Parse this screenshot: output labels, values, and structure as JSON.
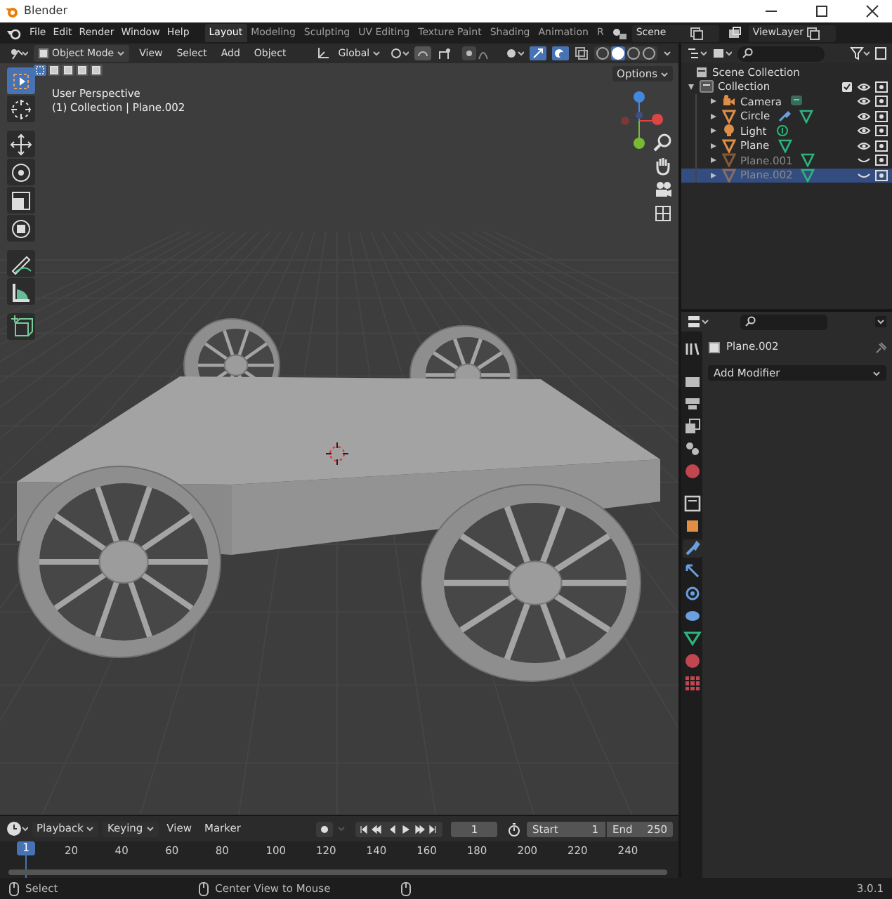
{
  "window": {
    "title": "Blender"
  },
  "menu": [
    "File",
    "Edit",
    "Render",
    "Window",
    "Help"
  ],
  "workspaces": [
    {
      "label": "Layout",
      "selected": true
    },
    {
      "label": "Modeling",
      "selected": false
    },
    {
      "label": "Sculpting",
      "selected": false
    },
    {
      "label": "UV Editing",
      "selected": false
    },
    {
      "label": "Texture Paint",
      "selected": false
    },
    {
      "label": "Shading",
      "selected": false
    },
    {
      "label": "Animation",
      "selected": false
    },
    {
      "label": "R",
      "selected": false
    }
  ],
  "scene": "Scene",
  "view_layer": "ViewLayer",
  "viewport": {
    "mode": "Object Mode",
    "menus": [
      "View",
      "Select",
      "Add",
      "Object"
    ],
    "orientation": "Global",
    "options": "Options",
    "overlay_lines": [
      "User Perspective",
      "(1) Collection | Plane.002"
    ],
    "select_modes": [
      {
        "selected": true
      },
      {
        "selected": false
      },
      {
        "selected": false
      },
      {
        "selected": false
      },
      {
        "selected": false
      }
    ],
    "tools": [
      {
        "kind": "select",
        "selected": true
      },
      {
        "kind": "cursor",
        "selected": false
      },
      {
        "kind": "move",
        "selected": false
      },
      {
        "kind": "rotate",
        "selected": false
      },
      {
        "kind": "scale",
        "selected": false
      },
      {
        "kind": "transform",
        "selected": false
      },
      {
        "kind": "annotate",
        "selected": false
      },
      {
        "kind": "measure",
        "selected": false
      },
      {
        "kind": "add-cube",
        "selected": false
      }
    ],
    "shading": [
      {
        "selected": false
      },
      {
        "selected": true
      },
      {
        "selected": false
      },
      {
        "selected": false
      }
    ]
  },
  "outliner": {
    "root": "Scene Collection",
    "items": [
      {
        "label": "Collection",
        "kind": "collection",
        "expanded": true,
        "checked": true,
        "children": [
          {
            "label": "Camera",
            "kind": "camera",
            "has_modifier": false,
            "hidden": false,
            "selected": false
          },
          {
            "label": "Circle",
            "kind": "mesh",
            "has_modifier": true,
            "hidden": false,
            "selected": false
          },
          {
            "label": "Light",
            "kind": "light",
            "has_modifier": false,
            "hidden": false,
            "selected": false
          },
          {
            "label": "Plane",
            "kind": "mesh",
            "has_modifier": false,
            "hidden": false,
            "selected": false
          },
          {
            "label": "Plane.001",
            "kind": "mesh",
            "has_modifier": false,
            "hidden": true,
            "selected": false
          },
          {
            "label": "Plane.002",
            "kind": "mesh",
            "has_modifier": false,
            "hidden": true,
            "selected": true
          }
        ]
      }
    ]
  },
  "properties": {
    "object": "Plane.002",
    "add_modifier": "Add Modifier",
    "tabs": [
      {
        "kind": "tool",
        "selected": false
      },
      {
        "kind": "render",
        "selected": false
      },
      {
        "kind": "output",
        "selected": false
      },
      {
        "kind": "view-layer",
        "selected": false
      },
      {
        "kind": "scene",
        "selected": false
      },
      {
        "kind": "world",
        "selected": false
      },
      {
        "kind": "collection",
        "selected": false
      },
      {
        "kind": "object",
        "selected": false
      },
      {
        "kind": "modifier",
        "selected": true
      },
      {
        "kind": "particles",
        "selected": false
      },
      {
        "kind": "physics",
        "selected": false
      },
      {
        "kind": "constraints",
        "selected": false
      },
      {
        "kind": "data",
        "selected": false
      },
      {
        "kind": "material",
        "selected": false
      },
      {
        "kind": "texture",
        "selected": false
      }
    ]
  },
  "timeline": {
    "menus": [
      "Playback",
      "Keying",
      "View",
      "Marker"
    ],
    "current_frame": "1",
    "start_label": "Start",
    "start": "1",
    "end_label": "End",
    "end": "250",
    "marker": "1",
    "ruler": [
      "20",
      "40",
      "60",
      "80",
      "100",
      "120",
      "140",
      "160",
      "180",
      "200",
      "220",
      "240"
    ]
  },
  "status_bar": {
    "hints": [
      "Select",
      "Center View to Mouse"
    ],
    "version": "3.0.1"
  }
}
